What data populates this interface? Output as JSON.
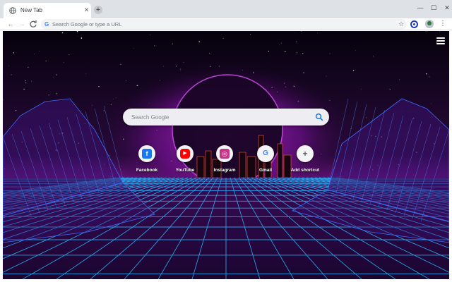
{
  "browser": {
    "tab": {
      "title": "New Tab",
      "favicon": "globe-icon",
      "close": "✕"
    },
    "new_tab": "+",
    "window_controls": {
      "minimize": "—",
      "maximize": "☐",
      "close": "✕"
    }
  },
  "toolbar": {
    "back": "←",
    "forward": "→",
    "reload": "C",
    "omnibox": {
      "icon_letter": "G",
      "placeholder": "Search Google or type a URL",
      "value": ""
    },
    "bookmark_star": "☆",
    "menu": "⋮"
  },
  "newtab": {
    "menu_icon": "hamburger-icon",
    "search": {
      "placeholder": "Search Google",
      "icon": "search-icon"
    },
    "shortcuts": [
      {
        "label": "Facebook",
        "icon": "facebook-icon",
        "glyph": "f",
        "color": "#1877f2"
      },
      {
        "label": "YouTube",
        "icon": "youtube-icon",
        "glyph": "▶",
        "color": "#ff0000"
      },
      {
        "label": "Instagram",
        "icon": "instagram-icon",
        "glyph": "◎",
        "color": "#c13584"
      },
      {
        "label": "Gmail",
        "icon": "google-icon",
        "glyph": "G",
        "color": "#4285f4"
      },
      {
        "label": "Add shortcut",
        "icon": "plus-icon",
        "glyph": "+",
        "color": "#5f6368"
      }
    ]
  },
  "colors": {
    "tabstrip": "#dee1e6",
    "grid_line": "#2ab8ff",
    "sky": "#07020f",
    "horizon_glow": "#a21bbf"
  }
}
